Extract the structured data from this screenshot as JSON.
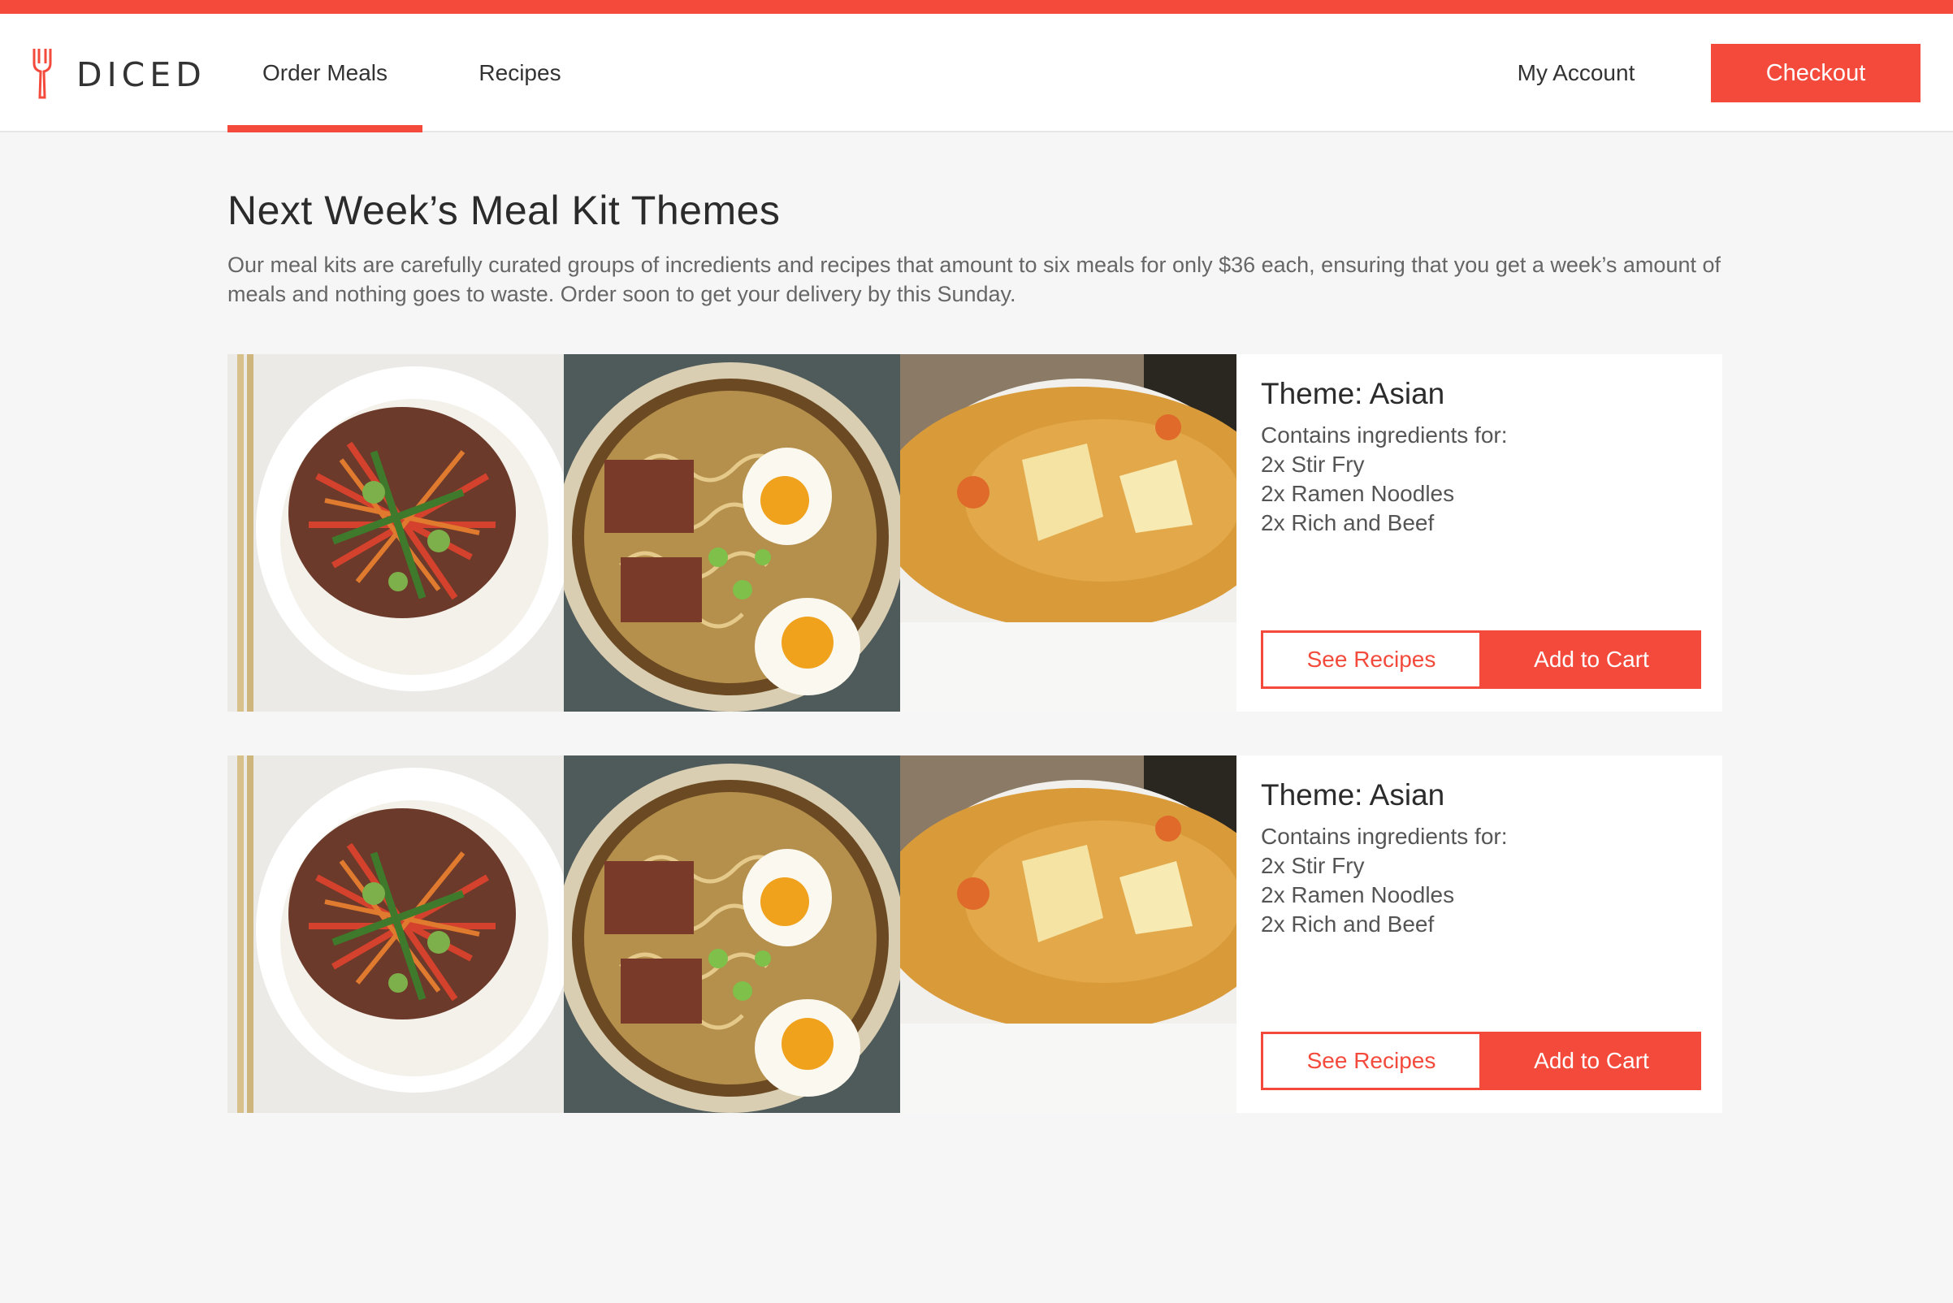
{
  "header": {
    "logo_text": "DICED",
    "nav": {
      "order_meals": "Order Meals",
      "recipes": "Recipes",
      "my_account": "My Account"
    },
    "checkout_label": "Checkout",
    "active_tab": "Order Meals"
  },
  "main": {
    "title": "Next Week’s Meal Kit Themes",
    "description": "Our meal kits are carefully curated groups of incredients and recipes that amount to six meals for only $36 each, ensuring that you get a week’s amount of meals and nothing goes to waste. Order soon to get your delivery by this Sunday."
  },
  "kits": [
    {
      "theme": "Theme: Asian",
      "contains_label": "Contains ingredients for:",
      "items": [
        "2x Stir Fry",
        "2x Ramen Noodles",
        "2x Rich and Beef"
      ],
      "photos": [
        "stir-fry-photo",
        "ramen-photo",
        "curry-soup-photo"
      ],
      "see_recipes_label": "See Recipes",
      "add_to_cart_label": "Add to Cart"
    },
    {
      "theme": "Theme: Asian",
      "contains_label": "Contains ingredients for:",
      "items": [
        "2x Stir Fry",
        "2x Ramen Noodles",
        "2x Rich and Beef"
      ],
      "photos": [
        "stir-fry-photo",
        "ramen-photo",
        "curry-soup-photo"
      ],
      "see_recipes_label": "See Recipes",
      "add_to_cart_label": "Add to Cart"
    }
  ],
  "colors": {
    "accent": "#f44a3c",
    "background": "#f6f6f6",
    "card": "#ffffff"
  }
}
